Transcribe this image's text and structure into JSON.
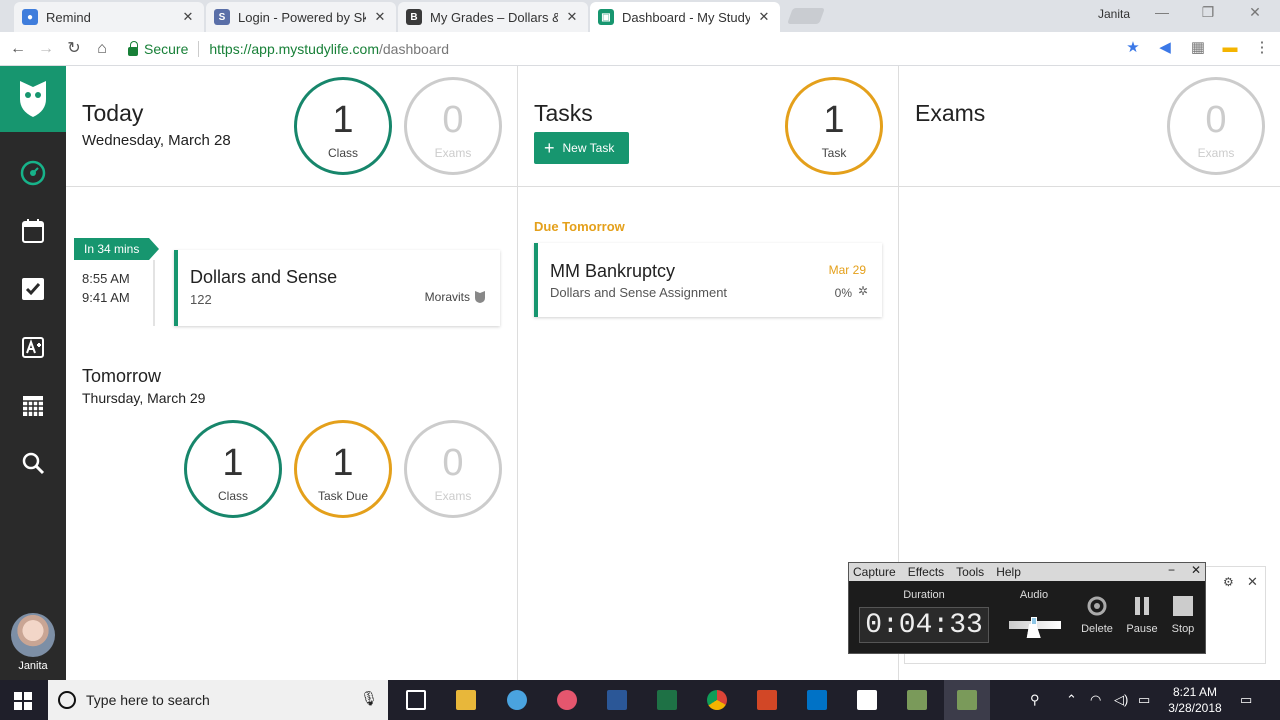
{
  "browser": {
    "tabs": [
      {
        "title": "Remind",
        "color": "#3f7ddc"
      },
      {
        "title": "Login - Powered by Skyw",
        "color": "#5a6fa8"
      },
      {
        "title": "My Grades – Dollars & Se",
        "color": "#3a3a3a"
      },
      {
        "title": "Dashboard - My Study Li",
        "color": "#17966f"
      }
    ],
    "user": "Janita",
    "secure_label": "Secure",
    "url_host": "https://app.mystudylife.com",
    "url_path": "/dashboard"
  },
  "sidebar": {
    "user_name": "Janita"
  },
  "today": {
    "heading": "Today",
    "date": "Wednesday, March 28",
    "classes": {
      "count": "1",
      "label": "Class"
    },
    "exams": {
      "count": "0",
      "label": "Exams"
    }
  },
  "tasks": {
    "heading": "Tasks",
    "new_task_label": "New Task",
    "count": "1",
    "count_label": "Task",
    "due_label": "Due Tomorrow",
    "items": [
      {
        "title": "MM Bankruptcy",
        "subject": "Dollars and Sense Assignment",
        "due": "Mar 29",
        "progress": "0%"
      }
    ]
  },
  "exams": {
    "heading": "Exams",
    "count": "0",
    "count_label": "Exams"
  },
  "schedule": {
    "badge": "In 34 mins",
    "start": "8:55 AM",
    "end": "9:41 AM",
    "class_name": "Dollars and Sense",
    "room": "122",
    "teacher": "Moravits"
  },
  "tomorrow": {
    "heading": "Tomorrow",
    "date": "Thursday, March 29",
    "classes": {
      "count": "1",
      "label": "Class"
    },
    "tasks_due": {
      "count": "1",
      "label": "Task Due"
    },
    "exams": {
      "count": "0",
      "label": "Exams"
    }
  },
  "recorder": {
    "menu": [
      "Capture",
      "Effects",
      "Tools",
      "Help"
    ],
    "duration_label": "Duration",
    "duration": "0:04:33",
    "audio_label": "Audio",
    "delete_label": "Delete",
    "pause_label": "Pause",
    "stop_label": "Stop"
  },
  "taskbar": {
    "search_placeholder": "Type here to search",
    "time": "8:21 AM",
    "date": "3/28/2018"
  },
  "colors": {
    "brand_green": "#17966f",
    "task_orange": "#e4a01b",
    "inactive_grey": "#cccccc"
  }
}
